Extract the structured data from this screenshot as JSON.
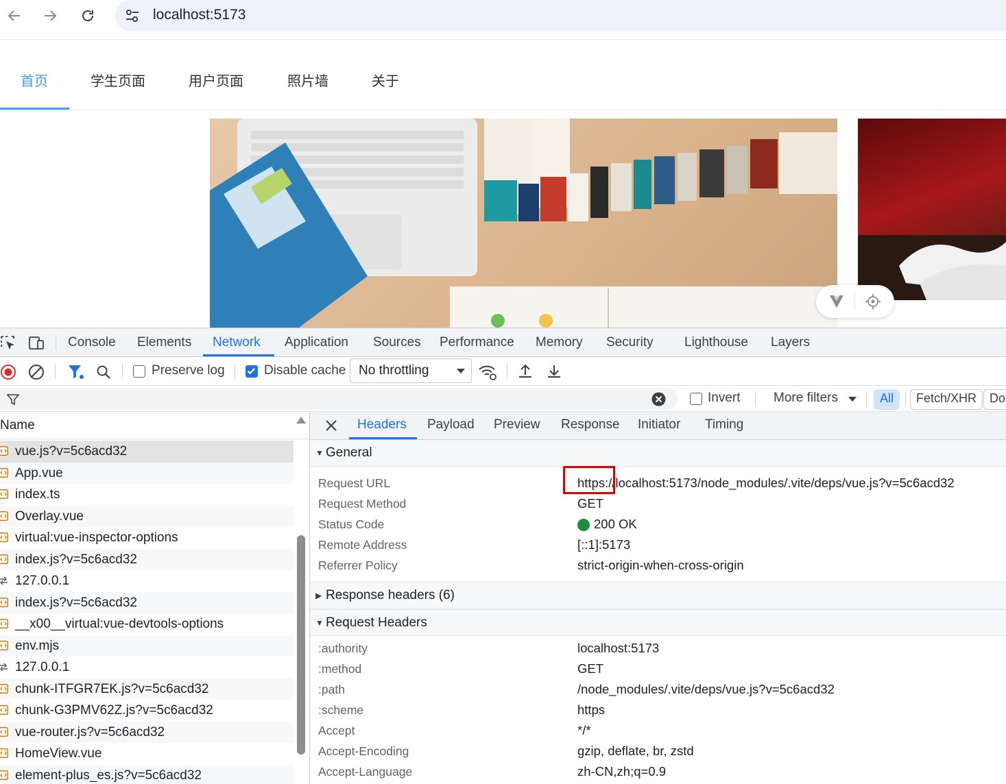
{
  "browser": {
    "url": "localhost:5173"
  },
  "app_nav": {
    "tabs": [
      {
        "label": "首页",
        "active": true
      },
      {
        "label": "学生页面"
      },
      {
        "label": "用户页面"
      },
      {
        "label": "照片墙"
      },
      {
        "label": "关于"
      }
    ]
  },
  "devtools": {
    "tabs": [
      {
        "label": "Console"
      },
      {
        "label": "Elements"
      },
      {
        "label": "Network",
        "active": true
      },
      {
        "label": "Application"
      },
      {
        "label": "Sources"
      },
      {
        "label": "Performance"
      },
      {
        "label": "Memory"
      },
      {
        "label": "Security"
      },
      {
        "label": "Lighthouse"
      },
      {
        "label": "Layers"
      }
    ],
    "toolbar": {
      "preserve_log": "Preserve log",
      "preserve_log_checked": false,
      "disable_cache": "Disable cache",
      "disable_cache_checked": true,
      "throttling": "No throttling"
    },
    "filter": {
      "invert": "Invert",
      "more_filters": "More filters",
      "type_all": "All",
      "type_fetch": "Fetch/XHR",
      "type_doc": "Do"
    },
    "request_list": {
      "header": "Name",
      "rows": [
        {
          "name": "vue.js?v=5c6acd32",
          "type": "script"
        },
        {
          "name": "App.vue",
          "type": "script"
        },
        {
          "name": "index.ts",
          "type": "script"
        },
        {
          "name": "Overlay.vue",
          "type": "script"
        },
        {
          "name": "virtual:vue-inspector-options",
          "type": "script"
        },
        {
          "name": "index.js?v=5c6acd32",
          "type": "script"
        },
        {
          "name": "127.0.0.1",
          "type": "websocket"
        },
        {
          "name": "index.js?v=5c6acd32",
          "type": "script"
        },
        {
          "name": "__x00__virtual:vue-devtools-options",
          "type": "script"
        },
        {
          "name": "env.mjs",
          "type": "script"
        },
        {
          "name": "127.0.0.1",
          "type": "websocket"
        },
        {
          "name": "chunk-ITFGR7EK.js?v=5c6acd32",
          "type": "script"
        },
        {
          "name": "chunk-G3PMV62Z.js?v=5c6acd32",
          "type": "script"
        },
        {
          "name": "vue-router.js?v=5c6acd32",
          "type": "script"
        },
        {
          "name": "HomeView.vue",
          "type": "script"
        },
        {
          "name": "element-plus_es.js?v=5c6acd32",
          "type": "script"
        }
      ]
    },
    "details": {
      "tabs": [
        {
          "label": "Headers",
          "active": true
        },
        {
          "label": "Payload"
        },
        {
          "label": "Preview"
        },
        {
          "label": "Response"
        },
        {
          "label": "Initiator"
        },
        {
          "label": "Timing"
        }
      ],
      "general": {
        "title": "General",
        "rows": [
          {
            "key": "Request URL",
            "value": "https://localhost:5173/node_modules/.vite/deps/vue.js?v=5c6acd32"
          },
          {
            "key": "Request Method",
            "value": "GET"
          },
          {
            "key": "Status Code",
            "value": "200 OK"
          },
          {
            "key": "Remote Address",
            "value": "[::1]:5173"
          },
          {
            "key": "Referrer Policy",
            "value": "strict-origin-when-cross-origin"
          }
        ]
      },
      "response_headers": {
        "title": "Response headers (6)"
      },
      "request_headers": {
        "title": "Request Headers",
        "rows": [
          {
            "key": ":authority",
            "value": "localhost:5173"
          },
          {
            "key": ":method",
            "value": "GET"
          },
          {
            "key": ":path",
            "value": "/node_modules/.vite/deps/vue.js?v=5c6acd32"
          },
          {
            "key": ":scheme",
            "value": "https"
          },
          {
            "key": "Accept",
            "value": "*/*"
          },
          {
            "key": "Accept-Encoding",
            "value": "gzip, deflate, br, zstd"
          },
          {
            "key": "Accept-Language",
            "value": "zh-CN,zh;q=0.9"
          }
        ]
      }
    }
  },
  "colors": {
    "accent": "#1a73e8",
    "app_accent": "#409eff",
    "status_ok": "#1e8e3e",
    "highlight": "#e00000"
  }
}
